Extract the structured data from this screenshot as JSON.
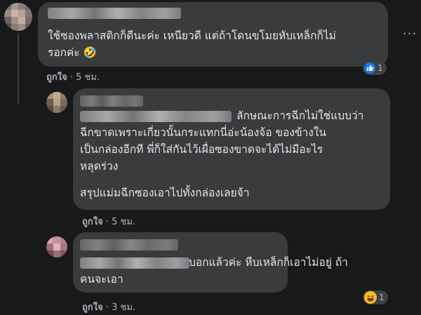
{
  "comments": [
    {
      "text_lines": [
        "ใช้ซองพลาสติกก็ดีนะค่ะ เหนียวดี แต่ถ้าโดนขโมยหับเหล็กก็ไม่",
        "รอกค่ะ 🤣"
      ],
      "like_label": "ถูกใจ",
      "time": "5 ชม.",
      "reaction_count": "1"
    },
    {
      "text_lines": [
        "ลักษณะการฉีกไม่ใช่แบบว่า",
        "ฉีกขาดเพราะเกี่ยวนั้นกระแทกนี่อ่ะน้องจ้อ ของข้างใน",
        "เป็นกล่องอีกที พี่ก็ใส่กันไว้เผื่อซองขาดจะได้ไม่มีอะไร",
        "หลุดร่วง",
        "สรุปแม่มฉีกซองเอาไปทั้งกล่องเลยจ้า"
      ],
      "like_label": "ถูกใจ",
      "time": "5 ชม."
    },
    {
      "text_lines": [
        "บอกแล้วค่ะ หืบเหล็กก็เอาไม่อยู่ ถ้า",
        "คนจะเอา"
      ],
      "like_label": "ถูกใจ",
      "time": "3 ชม.",
      "reaction_count": "1"
    }
  ],
  "ui": {
    "more_glyph": "···",
    "sep": "·"
  },
  "colors": {
    "bubble": "#3a3b3c",
    "background": "#18191a",
    "like_blue": "#1877f2",
    "haha_yellow": "#f7b928"
  }
}
